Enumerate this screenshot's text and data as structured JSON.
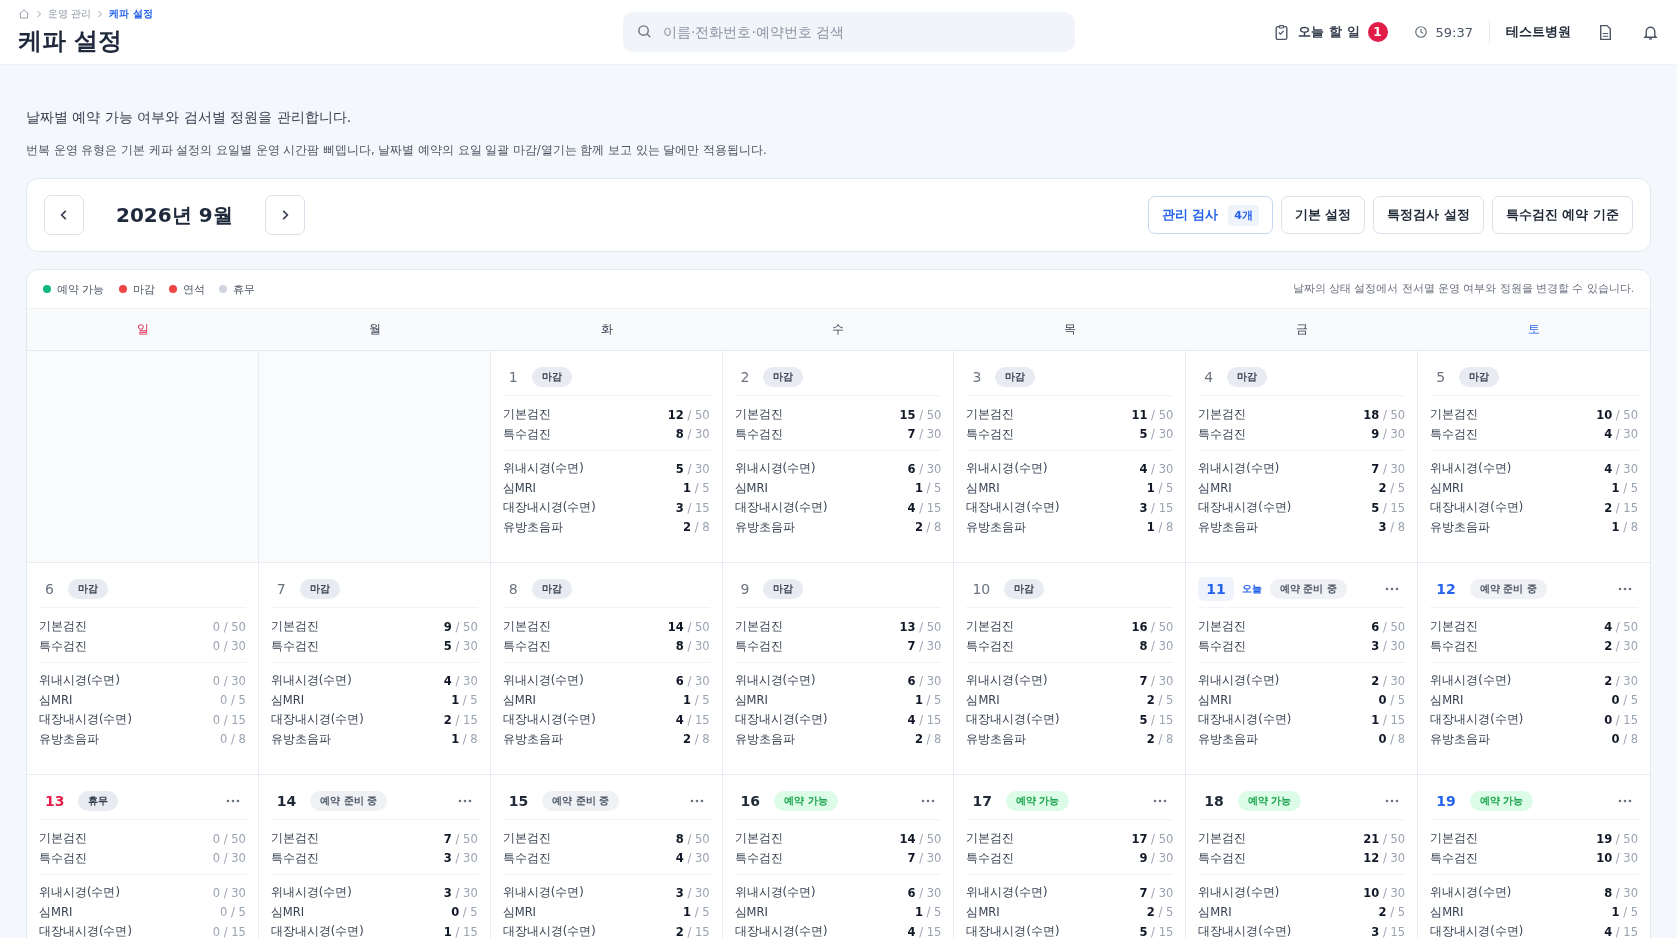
{
  "breadcrumb": [
    {
      "label": "운영 관리",
      "current": false
    },
    {
      "label": "케파 설정",
      "current": true
    }
  ],
  "title": "케파 설정",
  "search": {
    "placeholder": "이름·전화번호·예약번호 검색"
  },
  "topbar": {
    "todo_label": "오늘 할 일",
    "todo_count": "1",
    "timer": "59:37",
    "hospital": "테스트병원"
  },
  "intro": {
    "lead": "날짜별 예약 가능 여부와 검서별 정원을 관리합니다.",
    "note": "번복 운영 유형은 기본 케파 설정의 요일별 운영 시간팜 삐뎁니다, 날짜별 예약의 요일 일괄 마감/열기는 함께 보고 있는 달에만 적용됩니다."
  },
  "month": "2026년 9월",
  "actions": [
    {
      "label": "관리 검사",
      "badge": "4개",
      "primary": true
    },
    {
      "label": "기본 설정",
      "primary": false
    },
    {
      "label": "특정검사 설정",
      "primary": false
    },
    {
      "label": "특수검진 예약 기준",
      "primary": false
    }
  ],
  "legend": [
    {
      "label": "예약 가능",
      "color": "#10b981"
    },
    {
      "label": "마감",
      "color": "#ef4444"
    },
    {
      "label": "연석",
      "color": "#ef4444"
    },
    {
      "label": "휴무",
      "color": "#d1d5e0"
    }
  ],
  "legend_note": "날짜의 상태 설정에서 전서멸 운영 여부와 정원을 변경할 수 있습니다.",
  "weekdays": [
    {
      "label": "일",
      "kind": "sun"
    },
    {
      "label": "월",
      "kind": "weekday"
    },
    {
      "label": "화",
      "kind": "weekday"
    },
    {
      "label": "수",
      "kind": "weekday"
    },
    {
      "label": "목",
      "kind": "weekday"
    },
    {
      "label": "금",
      "kind": "weekday"
    },
    {
      "label": "토",
      "kind": "sat"
    }
  ],
  "weeks": [
    [
      {
        "day": "1",
        "past": true,
        "status": {
          "kind": "closed",
          "label": "마감"
        },
        "menu": false,
        "general": [
          {
            "label": "기본검진",
            "value": "**12** / 50"
          },
          {
            "label": "특수검진",
            "value": "**8** / 30"
          }
        ],
        "exams": [
          {
            "label": "위내시경(수면)",
            "value": "**5** / 30"
          },
          {
            "label": "심MRI",
            "value": "**1** / 5"
          },
          {
            "label": "대장내시경(수면)",
            "value": "**3** / 15"
          },
          {
            "label": "유방초음파",
            "value": "**2** / 8"
          }
        ]
      },
      {
        "day": "2",
        "past": true,
        "status": {
          "kind": "closed",
          "label": "마감"
        },
        "menu": false,
        "general": [
          {
            "label": "기본검진",
            "value": "**15** / 50"
          },
          {
            "label": "특수검진",
            "value": "**7** / 30"
          }
        ],
        "exams": [
          {
            "label": "위내시경(수면)",
            "value": "**6** / 30"
          },
          {
            "label": "심MRI",
            "value": "**1** / 5"
          },
          {
            "label": "대장내시경(수면)",
            "value": "**4** / 15"
          },
          {
            "label": "유방초음파",
            "value": "**2** / 8"
          }
        ]
      },
      {
        "day": "3",
        "past": true,
        "status": {
          "kind": "closed",
          "label": "마감"
        },
        "menu": false,
        "general": [
          {
            "label": "기본검진",
            "value": "**11** / 50"
          },
          {
            "label": "특수검진",
            "value": "**5** / 30"
          }
        ],
        "exams": [
          {
            "label": "위내시경(수면)",
            "value": "**4** / 30"
          },
          {
            "label": "심MRI",
            "value": "**1** / 5"
          },
          {
            "label": "대장내시경(수면)",
            "value": "**3** / 15"
          },
          {
            "label": "유방초음파",
            "value": "**1** / 8"
          }
        ]
      },
      {
        "day": "4",
        "past": true,
        "status": {
          "kind": "closed",
          "label": "마감"
        },
        "menu": false,
        "general": [
          {
            "label": "기본검진",
            "value": "**18** / 50"
          },
          {
            "label": "특수검진",
            "value": "**9** / 30"
          }
        ],
        "exams": [
          {
            "label": "위내시경(수면)",
            "value": "**7** / 30"
          },
          {
            "label": "심MRI",
            "value": "**2** / 5"
          },
          {
            "label": "대장내시경(수면)",
            "value": "**5** / 15"
          },
          {
            "label": "유방초음파",
            "value": "**3** / 8"
          }
        ]
      },
      {
        "day": "5",
        "past": true,
        "status": {
          "kind": "closed",
          "label": "마감"
        },
        "menu": false,
        "general": [
          {
            "label": "기본검진",
            "value": "**10** / 50"
          },
          {
            "label": "특수검진",
            "value": "**4** / 30"
          }
        ],
        "exams": [
          {
            "label": "위내시경(수면)",
            "value": "**4** / 30"
          },
          {
            "label": "심MRI",
            "value": "**1** / 5"
          },
          {
            "label": "대장내시경(수면)",
            "value": "**2** / 15"
          },
          {
            "label": "유방초음파",
            "value": "**1** / 8"
          }
        ]
      }
    ],
    [
      {
        "day": "6",
        "past": true,
        "status": {
          "kind": "closed",
          "label": "마감"
        },
        "menu": false,
        "general": [
          {
            "label": "기본검진",
            "value": "0 / 50"
          },
          {
            "label": "특수검진",
            "value": "0 / 30"
          }
        ],
        "exams": [
          {
            "label": "위내시경(수면)",
            "value": "0 / 30"
          },
          {
            "label": "심MRI",
            "value": "0 / 5"
          },
          {
            "label": "대장내시경(수면)",
            "value": "0 / 15"
          },
          {
            "label": "유방초음파",
            "value": "0 / 8"
          }
        ]
      },
      {
        "day": "7",
        "past": true,
        "status": {
          "kind": "closed",
          "label": "마감"
        },
        "menu": false,
        "general": [
          {
            "label": "기본검진",
            "value": "**9** / 50"
          },
          {
            "label": "특수검진",
            "value": "**5** / 30"
          }
        ],
        "exams": [
          {
            "label": "위내시경(수면)",
            "value": "**4** / 30"
          },
          {
            "label": "심MRI",
            "value": "**1** / 5"
          },
          {
            "label": "대장내시경(수면)",
            "value": "**2** / 15"
          },
          {
            "label": "유방초음파",
            "value": "**1** / 8"
          }
        ]
      },
      {
        "day": "8",
        "past": true,
        "status": {
          "kind": "closed",
          "label": "마감"
        },
        "menu": false,
        "general": [
          {
            "label": "기본검진",
            "value": "**14** / 50"
          },
          {
            "label": "특수검진",
            "value": "**8** / 30"
          }
        ],
        "exams": [
          {
            "label": "위내시경(수면)",
            "value": "**6** / 30"
          },
          {
            "label": "심MRI",
            "value": "**1** / 5"
          },
          {
            "label": "대장내시경(수면)",
            "value": "**4** / 15"
          },
          {
            "label": "유방초음파",
            "value": "**2** / 8"
          }
        ]
      },
      {
        "day": "9",
        "past": true,
        "status": {
          "kind": "closed",
          "label": "마감"
        },
        "menu": false,
        "general": [
          {
            "label": "기본검진",
            "value": "**13** / 50"
          },
          {
            "label": "특수검진",
            "value": "**7** / 30"
          }
        ],
        "exams": [
          {
            "label": "위내시경(수면)",
            "value": "**6** / 30"
          },
          {
            "label": "심MRI",
            "value": "**1** / 5"
          },
          {
            "label": "대장내시경(수면)",
            "value": "**4** / 15"
          },
          {
            "label": "유방초음파",
            "value": "**2** / 8"
          }
        ]
      },
      {
        "day": "10",
        "past": true,
        "status": {
          "kind": "closed",
          "label": "마감"
        },
        "menu": false,
        "general": [
          {
            "label": "기본검진",
            "value": "**16** / 50"
          },
          {
            "label": "특수검진",
            "value": "**8** / 30"
          }
        ],
        "exams": [
          {
            "label": "위내시경(수면)",
            "value": "**7** / 30"
          },
          {
            "label": "심MRI",
            "value": "**2** / 5"
          },
          {
            "label": "대장내시경(수면)",
            "value": "**5** / 15"
          },
          {
            "label": "유방초음파",
            "value": "**2** / 8"
          }
        ]
      },
      {
        "day": "11",
        "past": false,
        "today": true,
        "today_label": "오늘",
        "status": {
          "kind": "preparing",
          "label": "예약 준비 중"
        },
        "menu": true,
        "general": [
          {
            "label": "기본검진",
            "value": "**6** / 50"
          },
          {
            "label": "특수검진",
            "value": "**3** / 30"
          }
        ],
        "exams": [
          {
            "label": "위내시경(수면)",
            "value": "**2** / 30"
          },
          {
            "label": "심MRI",
            "value": "**0** / 5"
          },
          {
            "label": "대장내시경(수면)",
            "value": "**1** / 15"
          },
          {
            "label": "유방초음파",
            "value": "**0** / 8"
          }
        ]
      },
      {
        "day": "12",
        "past": false,
        "status": {
          "kind": "preparing",
          "label": "예약 준비 중"
        },
        "menu": true,
        "general": [
          {
            "label": "기본검진",
            "value": "**4** / 50"
          },
          {
            "label": "특수검진",
            "value": "**2** / 30"
          }
        ],
        "exams": [
          {
            "label": "위내시경(수면)",
            "value": "**2** / 30"
          },
          {
            "label": "심MRI",
            "value": "**0** / 5"
          },
          {
            "label": "대장내시경(수면)",
            "value": "**0** / 15"
          },
          {
            "label": "유방초음파",
            "value": "**0** / 8"
          }
        ]
      }
    ],
    [
      {
        "day": "13",
        "past": false,
        "status": {
          "kind": "holiday",
          "label": "휴무"
        },
        "menu": true,
        "general": [
          {
            "label": "기본검진",
            "value": "0 / 50"
          },
          {
            "label": "특수검진",
            "value": "0 / 30"
          }
        ],
        "exams": [
          {
            "label": "위내시경(수면)",
            "value": "0 / 30"
          },
          {
            "label": "심MRI",
            "value": "0 / 5"
          },
          {
            "label": "대장내시경(수면)",
            "value": "0 / 15"
          }
        ]
      },
      {
        "day": "14",
        "past": false,
        "status": {
          "kind": "preparing",
          "label": "예약 준비 중"
        },
        "menu": true,
        "general": [
          {
            "label": "기본검진",
            "value": "**7** / 50"
          },
          {
            "label": "특수검진",
            "value": "**3** / 30"
          }
        ],
        "exams": [
          {
            "label": "위내시경(수면)",
            "value": "**3** / 30"
          },
          {
            "label": "심MRI",
            "value": "**0** / 5"
          },
          {
            "label": "대장내시경(수면)",
            "value": "**1** / 15"
          }
        ]
      },
      {
        "day": "15",
        "past": false,
        "status": {
          "kind": "preparing",
          "label": "예약 준비 중"
        },
        "menu": true,
        "general": [
          {
            "label": "기본검진",
            "value": "**8** / 50"
          },
          {
            "label": "특수검진",
            "value": "**4** / 30"
          }
        ],
        "exams": [
          {
            "label": "위내시경(수면)",
            "value": "**3** / 30"
          },
          {
            "label": "심MRI",
            "value": "**1** / 5"
          },
          {
            "label": "대장내시경(수면)",
            "value": "**2** / 15"
          }
        ]
      },
      {
        "day": "16",
        "past": false,
        "status": {
          "kind": "open",
          "label": "예약 가능"
        },
        "menu": true,
        "general": [
          {
            "label": "기본검진",
            "value": "**14** / 50"
          },
          {
            "label": "특수검진",
            "value": "**7** / 30"
          }
        ],
        "exams": [
          {
            "label": "위내시경(수면)",
            "value": "**6** / 30"
          },
          {
            "label": "심MRI",
            "value": "**1** / 5"
          },
          {
            "label": "대장내시경(수면)",
            "value": "**4** / 15"
          }
        ]
      },
      {
        "day": "17",
        "past": false,
        "status": {
          "kind": "open",
          "label": "예약 가능"
        },
        "menu": true,
        "general": [
          {
            "label": "기본검진",
            "value": "**17** / 50"
          },
          {
            "label": "특수검진",
            "value": "**9** / 30"
          }
        ],
        "exams": [
          {
            "label": "위내시경(수면)",
            "value": "**7** / 30"
          },
          {
            "label": "심MRI",
            "value": "**2** / 5"
          },
          {
            "label": "대장내시경(수면)",
            "value": "**5** / 15"
          }
        ]
      },
      {
        "day": "18",
        "past": false,
        "status": {
          "kind": "open",
          "label": "예약 가능"
        },
        "menu": true,
        "general": [
          {
            "label": "기본검진",
            "value": "**21** / 50"
          },
          {
            "label": "특수검진",
            "value": "**12** / 30"
          }
        ],
        "exams": [
          {
            "label": "위내시경(수면)",
            "value": "**10** / 30"
          },
          {
            "label": "심MRI",
            "value": "**2** / 5"
          },
          {
            "label": "대장내시경(수면)",
            "value": "**3** / 15"
          }
        ]
      },
      {
        "day": "19",
        "past": false,
        "status": {
          "kind": "open",
          "label": "예약 가능"
        },
        "menu": true,
        "general": [
          {
            "label": "기본검진",
            "value": "**19** / 50"
          },
          {
            "label": "특수검진",
            "value": "**10** / 30"
          }
        ],
        "exams": [
          {
            "label": "위내시경(수면)",
            "value": "**8** / 30"
          },
          {
            "label": "심MRI",
            "value": "**1** / 5"
          },
          {
            "label": "대장내시경(수면)",
            "value": "**4** / 15"
          }
        ]
      }
    ]
  ]
}
